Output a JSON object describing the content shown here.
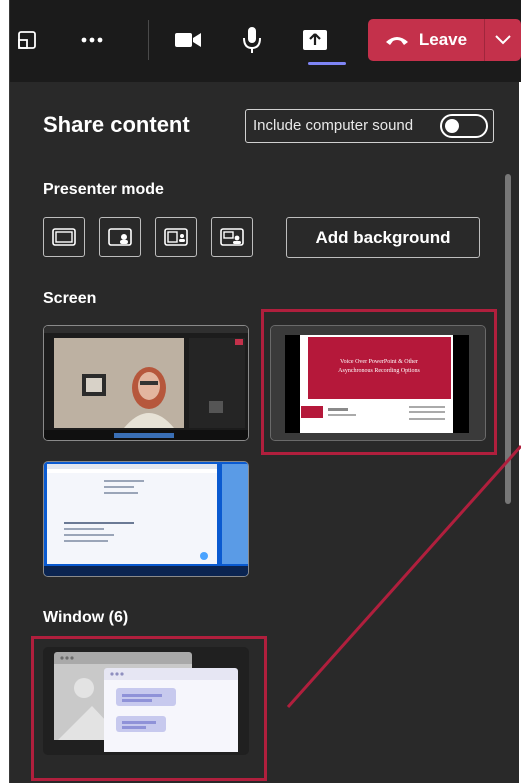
{
  "toolbar": {
    "leave_label": "Leave"
  },
  "panel": {
    "title": "Share content",
    "include_sound_label": "Include computer sound",
    "presenter_mode_heading": "Presenter mode",
    "add_background_label": "Add background",
    "screen_heading": "Screen",
    "window_heading": "Window (6)"
  },
  "slide": {
    "title_line1": "Voice Over PowerPoint & Other",
    "title_line2": "Asynchronous Recording Options"
  },
  "colors": {
    "leave": "#c4314b",
    "highlight": "#b01f3d",
    "accent": "#7f85f5"
  }
}
